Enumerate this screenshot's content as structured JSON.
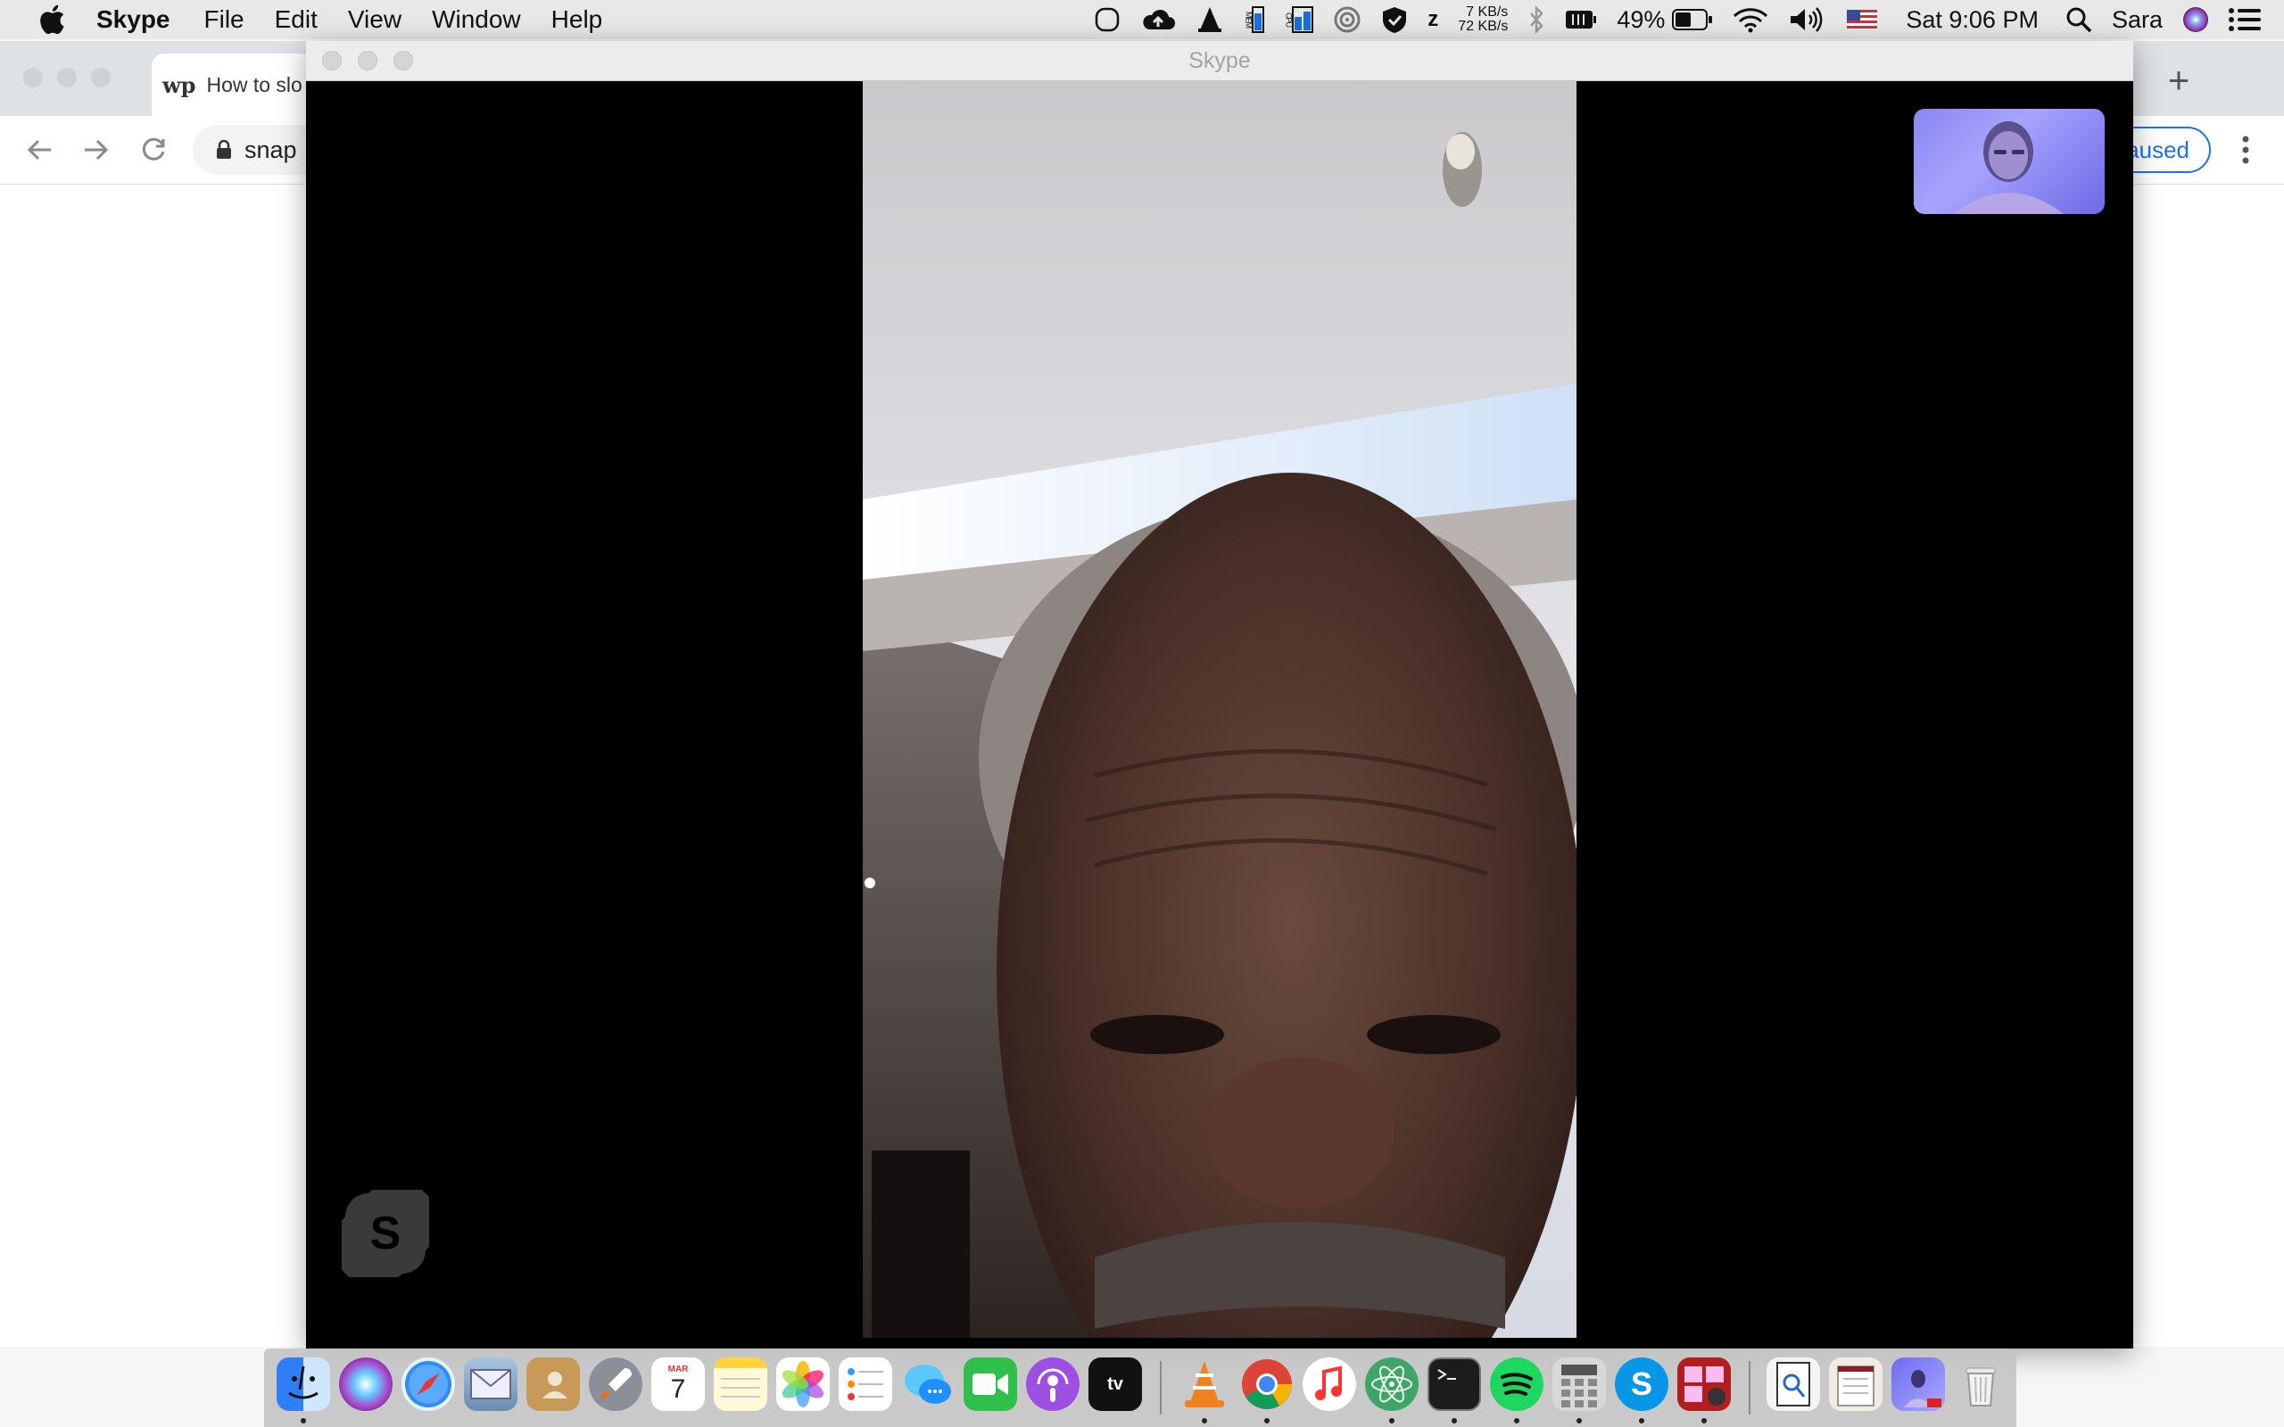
{
  "menubar": {
    "app_name": "Skype",
    "items": [
      "File",
      "Edit",
      "View",
      "Window",
      "Help"
    ],
    "status": {
      "net_up": "7 KB/s",
      "net_down": "72 KB/s",
      "battery": "49%",
      "clock": "Sat 9:06 PM",
      "user": "Sara",
      "mem_label": "MEM",
      "cpu_label": "CPU"
    }
  },
  "browser": {
    "tab_favicon": "wp",
    "tab_title": "How to slo",
    "url": "snap",
    "paused_label": "aused"
  },
  "skype_window": {
    "title": "Skype",
    "logo_letter": "S"
  },
  "dock": {
    "calendar_month": "MAR",
    "calendar_day": "7",
    "tv_label": "tv",
    "skype_letter": "S",
    "icons": [
      "finder-icon",
      "siri-icon",
      "safari-icon",
      "mail-icon",
      "contacts-icon",
      "launchpad-icon",
      "calendar-icon",
      "notes-icon",
      "photos-icon",
      "reminders-icon",
      "messages-icon",
      "facetime-icon",
      "podcasts-icon",
      "appletv-icon",
      "vlc-icon",
      "chrome-icon",
      "itunes-icon",
      "atom-icon",
      "terminal-icon",
      "spotify-icon",
      "calculator-icon",
      "skype-icon",
      "photobooth-icon",
      "preview-icon",
      "textedit-icon",
      "screenshot-icon",
      "trash-icon"
    ]
  }
}
